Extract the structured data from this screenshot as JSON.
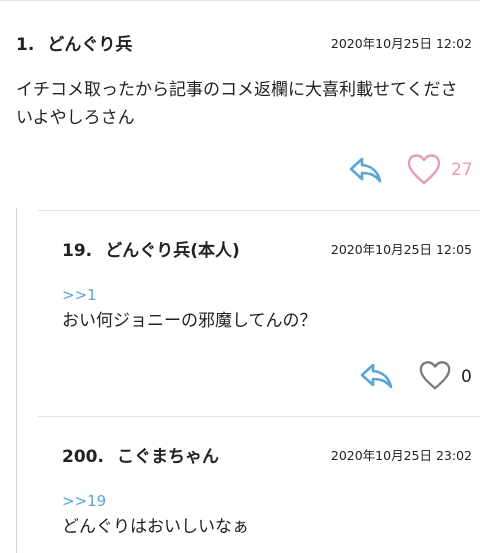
{
  "comments": [
    {
      "number": "1.",
      "name": "どんぐり兵",
      "date": "2020年10月25日 12:02",
      "reply_to": "",
      "body": "イチコメ取ったから記事のコメ返欄に大喜利載せてくださいよやしろさん",
      "likes": "27",
      "liked": true
    },
    {
      "number": "19.",
      "name": "どんぐり兵(本人)",
      "date": "2020年10月25日 12:05",
      "reply_to": ">>1",
      "body": "おい何ジョニーの邪魔してんの？",
      "likes": "0",
      "liked": false
    },
    {
      "number": "200.",
      "name": "こぐまちゃん",
      "date": "2020年10月25日 23:02",
      "reply_to": ">>19",
      "body": "どんぐりはおいしいなぁ",
      "likes": "",
      "liked": false
    }
  ],
  "colors": {
    "accent_link": "#5aa5d6",
    "liked_heart": "#e79bb4",
    "unliked_heart": "#7a7a7a",
    "divider": "#e2e2e2"
  },
  "icons": {
    "reply": "reply-arrow-icon",
    "like": "heart-icon"
  }
}
